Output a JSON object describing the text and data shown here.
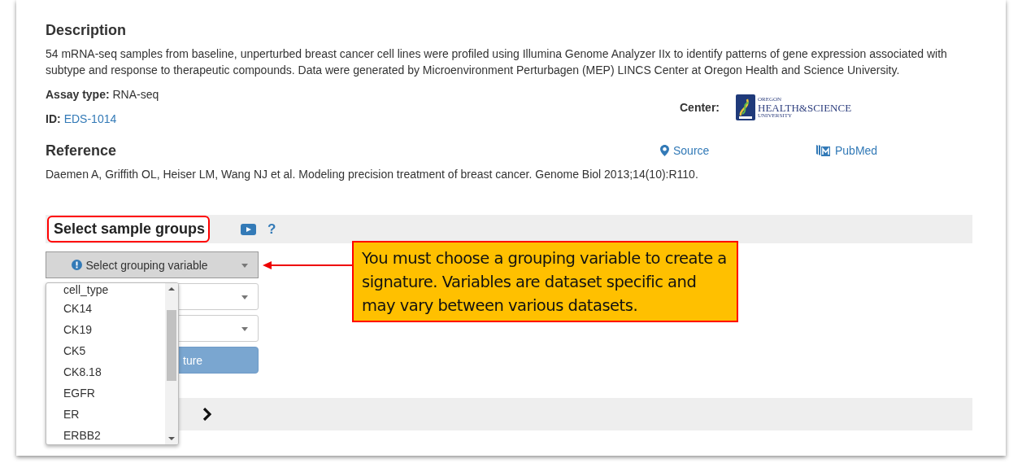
{
  "description": {
    "heading": "Description",
    "text": "54 mRNA-seq samples from baseline, unperturbed breast cancer cell lines were profiled using Illumina Genome Analyzer IIx to identify patterns of gene expression associated with subtype and response to therapeutic compounds. Data were generated by Microenvironment Perturbagen (MEP) LINCS Center at Oregon Health and Science University."
  },
  "assay_type": {
    "label": "Assay type:",
    "value": "RNA-seq"
  },
  "id": {
    "label": "ID:",
    "value": "EDS-1014"
  },
  "center": {
    "label": "Center:",
    "logo_lines": [
      "OREGON",
      "HEALTH&SCIENCE",
      "UNIVERSITY"
    ]
  },
  "reference": {
    "heading": "Reference",
    "text": "Daemen A, Griffith OL, Heiser LM, Wang NJ et al. Modeling precision treatment of breast cancer. Genome Biol 2013;14(10):R110.",
    "links": [
      {
        "label": "Source",
        "kind": "pin"
      },
      {
        "label": "PubMed",
        "kind": "pubmed"
      }
    ]
  },
  "sample_groups": {
    "heading": "Select sample groups",
    "help": "?",
    "grouping_select": {
      "label": "Select grouping variable",
      "expanded": true
    },
    "options": [
      "cell_type",
      "CK14",
      "CK19",
      "CK5",
      "CK8.18",
      "EGFR",
      "ER",
      "ERBB2"
    ],
    "create_button": "ture"
  },
  "callout": {
    "text": "You must choose a grouping variable to create a signature. Variables are dataset specific and may vary between various datasets."
  }
}
